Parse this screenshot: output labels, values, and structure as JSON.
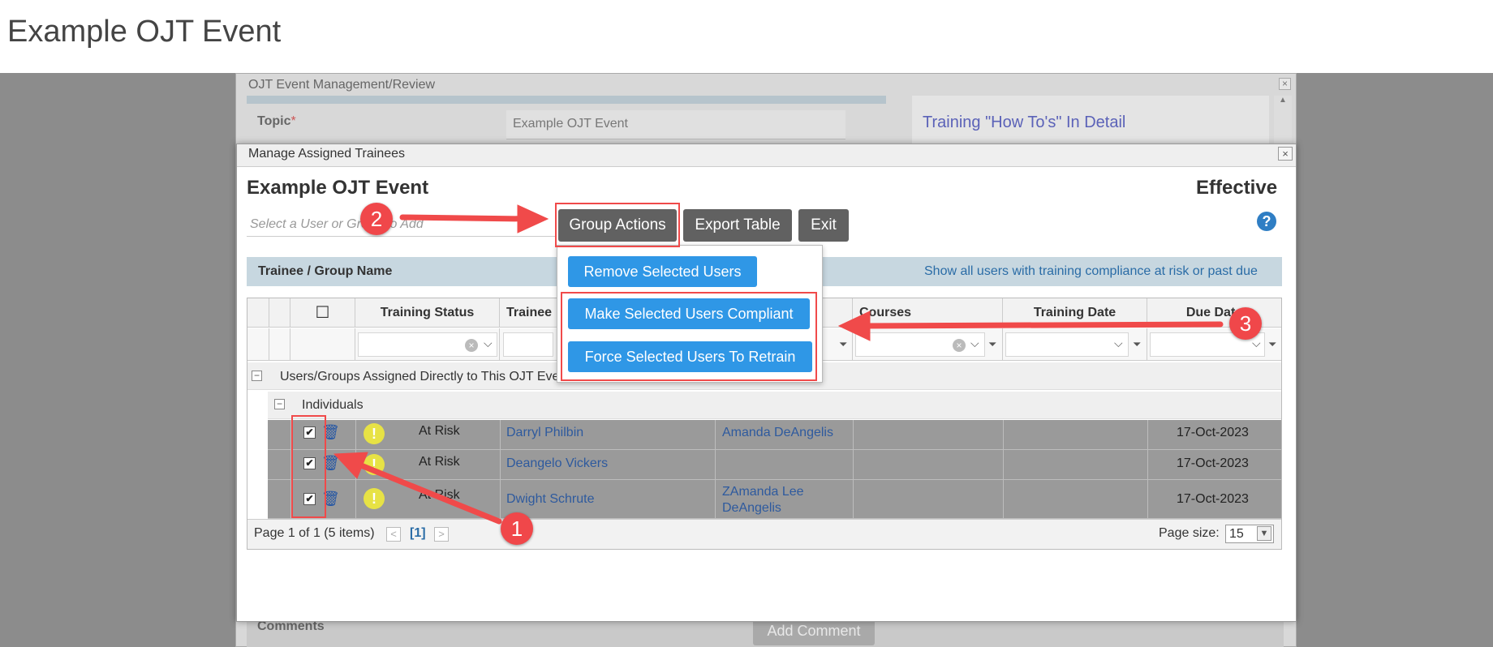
{
  "page": {
    "title": "Example OJT Event"
  },
  "background_window": {
    "title": "OJT Event Management/Review",
    "topic_label": "Topic",
    "required_mark": "*",
    "topic_value": "Example OJT Event",
    "howto_link": "Training \"How To's\" In Detail",
    "comments_label": "Comments",
    "add_comment_label": "Add Comment",
    "close_glyph": "×"
  },
  "modal": {
    "title": "Manage Assigned Trainees",
    "close_glyph": "×",
    "event_title": "Example OJT Event",
    "status": "Effective",
    "help_glyph": "?",
    "search_placeholder": "Select a User or Group to Add",
    "buttons": {
      "group_actions": "Group Actions",
      "export_table": "Export Table",
      "exit": "Exit"
    },
    "trainee_band_label": "Trainee / Group Name",
    "show_all_link": "Show all users with training compliance at risk or past due"
  },
  "group_actions_menu": {
    "items": [
      "Remove Selected Users",
      "Make Selected Users Compliant",
      "Force Selected Users To Retrain"
    ]
  },
  "grid": {
    "columns": [
      "",
      "",
      "☐",
      "Training Status",
      "Trainee",
      "",
      "Courses",
      "Training Date",
      "Due Date"
    ],
    "group_label": "Users/Groups Assigned Directly to This OJT Event",
    "subgroup_label": "Individuals",
    "rows": [
      {
        "checked": "✔",
        "status": "At Risk",
        "trainee": "Darryl Philbin",
        "supervisor": "Amanda DeAngelis",
        "courses": "",
        "training_date": "",
        "due_date": "17-Oct-2023"
      },
      {
        "checked": "✔",
        "status": "At Risk",
        "trainee": "Deangelo Vickers",
        "supervisor": "",
        "courses": "",
        "training_date": "",
        "due_date": "17-Oct-2023"
      },
      {
        "checked": "✔",
        "status": "At Risk",
        "trainee": "Dwight Schrute",
        "supervisor": "ZAmanda Lee DeAngelis",
        "courses": "",
        "training_date": "",
        "due_date": "17-Oct-2023"
      }
    ],
    "pager": {
      "info": "Page 1 of 1 (5 items)",
      "current_page": "[1]",
      "page_size_label": "Page size:",
      "page_size": "15",
      "prev_glyph": "<",
      "next_glyph": ">"
    }
  },
  "annotations": {
    "badges": [
      "1",
      "2",
      "3"
    ]
  },
  "colors": {
    "accent_blue": "#2f97e6",
    "dark_button": "#616161",
    "annotation_red": "#f0474a",
    "warning_yellow": "#e7e245"
  },
  "icons": {
    "warning": "!",
    "trash": "🗑",
    "clear": "×",
    "chevron": "⌄",
    "funnel": "⏷"
  }
}
